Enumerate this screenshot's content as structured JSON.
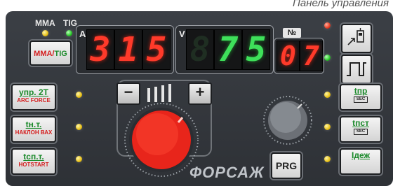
{
  "caption": "Панель управления",
  "mode": {
    "mma_label": "MMA",
    "tig_label": "TIG",
    "button_mma": "MMA/",
    "button_tig": "TIG"
  },
  "display_current": {
    "letter": "A",
    "digits": [
      "3",
      "1",
      "5"
    ]
  },
  "display_voltage": {
    "letter": "V",
    "digits": [
      "8",
      "7",
      "5"
    ]
  },
  "program": {
    "label": "№",
    "digits": [
      "0",
      "7"
    ]
  },
  "left_buttons": [
    {
      "line1": "упр. 2Т",
      "line2": "ARC FORCE"
    },
    {
      "line1": "tн.т.",
      "line2": "НАКЛОН ВАХ"
    },
    {
      "line1": "tсп.т.",
      "line2": "HOTSTART"
    }
  ],
  "right_buttons": [
    {
      "line1": "tпр",
      "sub": "SEC"
    },
    {
      "line1": "tпст",
      "sub": "SEC"
    },
    {
      "line1": "Iдеж",
      "sub": ""
    }
  ],
  "knob_minus": "−",
  "knob_plus": "+",
  "prg_label": "PRG",
  "brand": "ФОРСАЖ",
  "colors": {
    "panel": "#34383d",
    "digit_red": "#ff3a2a",
    "digit_green": "#3ee05a",
    "knob_red": "#e8251b",
    "label_green": "#1a8a2a",
    "label_red": "#d41e1e"
  }
}
